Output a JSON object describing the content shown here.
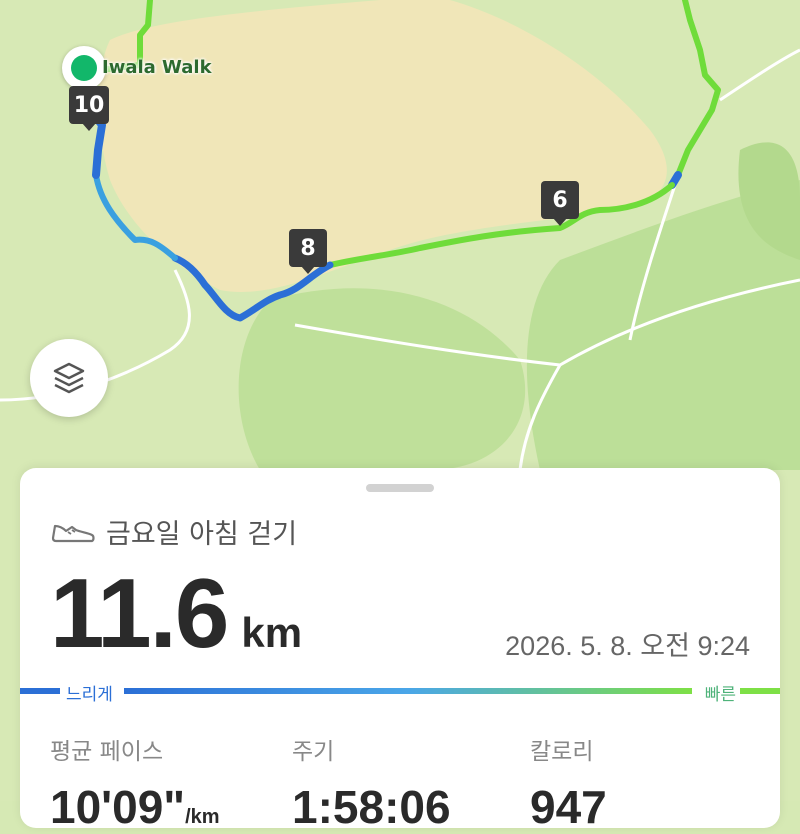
{
  "map": {
    "start_label": "Iwala Walk",
    "km_markers": [
      "10",
      "8",
      "6"
    ],
    "layers_icon": "layers-icon"
  },
  "activity": {
    "icon": "shoe-icon",
    "title": "금요일 아침 걷기",
    "distance_value": "11.6",
    "distance_unit": "km",
    "date": "2026. 5. 8. 오전 9:24"
  },
  "pace_legend": {
    "slow_label": "느리게",
    "fast_label": "빠른",
    "slow_color": "#2b6fd6",
    "fast_color": "#7ee046"
  },
  "stats": [
    {
      "label": "평균 페이스",
      "value": "10'09\"",
      "unit": "/km"
    },
    {
      "label": "주기",
      "value": "1:58:06",
      "unit": ""
    },
    {
      "label": "칼로리",
      "value": "947",
      "unit": ""
    }
  ]
}
